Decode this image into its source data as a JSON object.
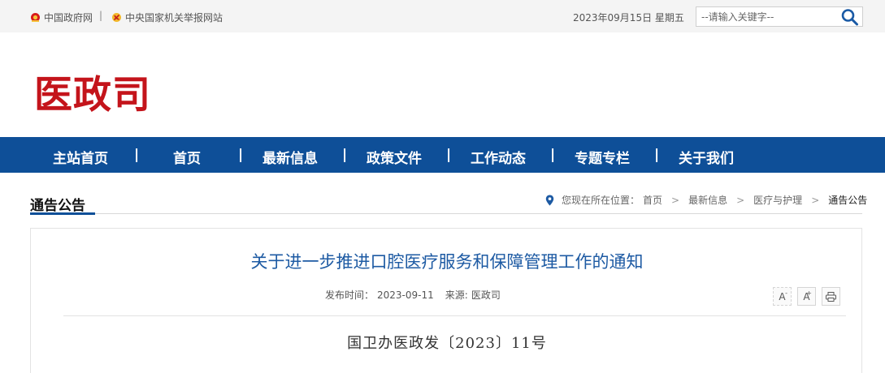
{
  "topbar": {
    "link1": "中国政府网",
    "separator": "|",
    "link2": "中央国家机关举报网站",
    "date": "2023年09月15日 星期五",
    "search_placeholder": "--请输入关键字--"
  },
  "logo": {
    "text": "医政司"
  },
  "nav": {
    "items": [
      "主站首页",
      "首页",
      "最新信息",
      "政策文件",
      "工作动态",
      "专题专栏",
      "关于我们"
    ],
    "separator": "|"
  },
  "section": {
    "title": "通告公告"
  },
  "breadcrumb": {
    "prefix": "您现在所在位置：",
    "items": [
      "首页",
      "最新信息",
      "医疗与护理",
      "通告公告"
    ],
    "arrow": ">"
  },
  "article": {
    "title": "关于进一步推进口腔医疗服务和保障管理工作的通知",
    "publish_label": "发布时间：",
    "publish_date": "2023-09-11",
    "source_label": "来源:",
    "source": "医政司",
    "doc_number": "国卫办医政发〔2023〕11号"
  },
  "tools": {
    "decrease": "A",
    "decrease_sup": "-",
    "increase": "A",
    "increase_sup": "+"
  },
  "colors": {
    "brand_red": "#c4141b",
    "nav_blue": "#0e4f98",
    "title_blue": "#1d5aa3"
  }
}
